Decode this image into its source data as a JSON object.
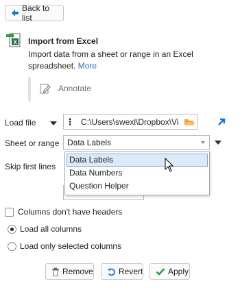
{
  "back_button": {
    "label": "Back to list"
  },
  "step": {
    "title": "Import from Excel",
    "desc_line1": "Import data from a sheet or range in an Excel",
    "desc_line2": "spreadsheet.",
    "more_link": "More",
    "annotate_label": "Annotate"
  },
  "load_file": {
    "label": "Load file",
    "path_value": "C:\\Users\\swexl\\Dropbox\\Vi"
  },
  "sheet_or_range": {
    "label": "Sheet or range",
    "selected": "Data Labels",
    "options": [
      "Data Labels",
      "Data Numbers",
      "Question Helper"
    ]
  },
  "skip_first_lines": {
    "label": "Skip first lines"
  },
  "options": {
    "no_headers_label": "Columns don't have headers",
    "load_all_label": "Load all columns",
    "load_selected_label": "Load only selected columns"
  },
  "actions": {
    "remove_label": "Remove",
    "revert_label": "Revert",
    "apply_label": "Apply"
  },
  "colors": {
    "accent": "#1a73d6",
    "apply_green": "#2e9e3a",
    "folder": "#f0a23b",
    "highlight": "#dbe9f8"
  }
}
